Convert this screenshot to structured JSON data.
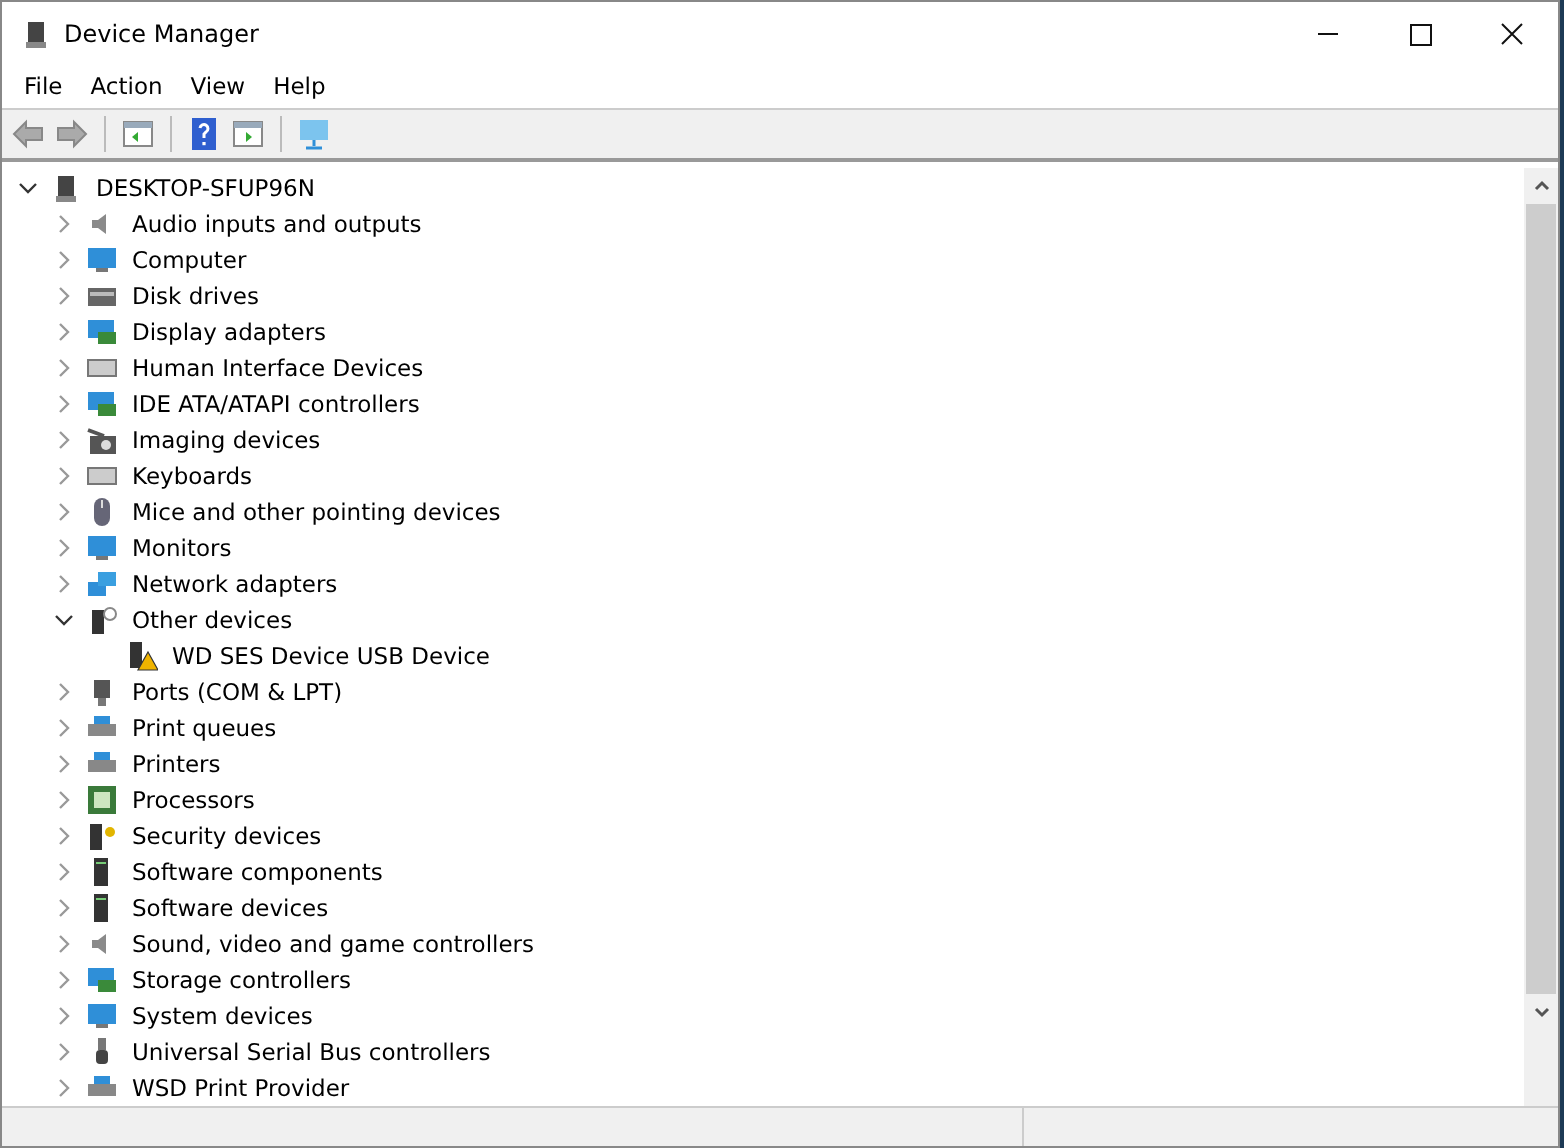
{
  "window": {
    "title": "Device Manager"
  },
  "menu": [
    "File",
    "Action",
    "View",
    "Help"
  ],
  "tree": {
    "label": "DESKTOP-SFUP96N",
    "expanded": true,
    "children": [
      {
        "label": "Audio inputs and outputs",
        "expanded": false
      },
      {
        "label": "Computer",
        "expanded": false
      },
      {
        "label": "Disk drives",
        "expanded": false
      },
      {
        "label": "Display adapters",
        "expanded": false
      },
      {
        "label": "Human Interface Devices",
        "expanded": false
      },
      {
        "label": "IDE ATA/ATAPI controllers",
        "expanded": false
      },
      {
        "label": "Imaging devices",
        "expanded": false
      },
      {
        "label": "Keyboards",
        "expanded": false
      },
      {
        "label": "Mice and other pointing devices",
        "expanded": false
      },
      {
        "label": "Monitors",
        "expanded": false
      },
      {
        "label": "Network adapters",
        "expanded": false
      },
      {
        "label": "Other devices",
        "expanded": true,
        "children": [
          {
            "label": "WD SES Device USB Device",
            "warning": true
          }
        ]
      },
      {
        "label": "Ports (COM & LPT)",
        "expanded": false
      },
      {
        "label": "Print queues",
        "expanded": false
      },
      {
        "label": "Printers",
        "expanded": false
      },
      {
        "label": "Processors",
        "expanded": false
      },
      {
        "label": "Security devices",
        "expanded": false
      },
      {
        "label": "Software components",
        "expanded": false
      },
      {
        "label": "Software devices",
        "expanded": false
      },
      {
        "label": "Sound, video and game controllers",
        "expanded": false
      },
      {
        "label": "Storage controllers",
        "expanded": false
      },
      {
        "label": "System devices",
        "expanded": false
      },
      {
        "label": "Universal Serial Bus controllers",
        "expanded": false
      },
      {
        "label": "WSD Print Provider",
        "expanded": false
      }
    ]
  }
}
